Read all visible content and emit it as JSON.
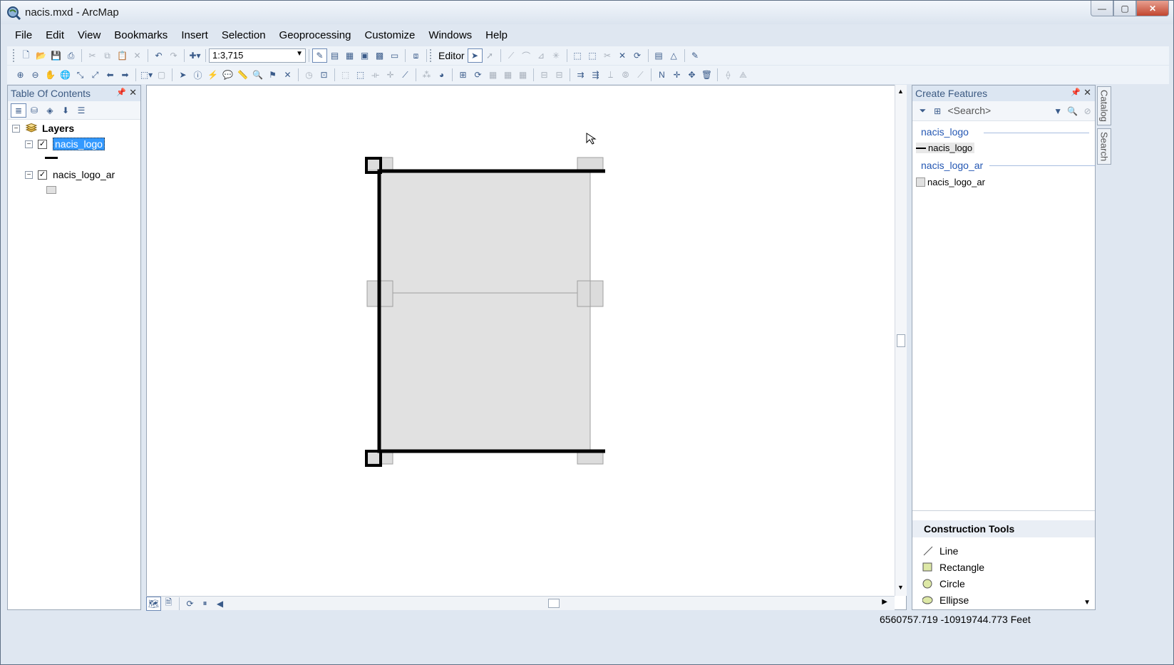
{
  "window": {
    "title": "nacis.mxd - ArcMap",
    "minimize_glyph": "—",
    "maximize_glyph": "▢",
    "close_glyph": "✕"
  },
  "menu": [
    "File",
    "Edit",
    "View",
    "Bookmarks",
    "Insert",
    "Selection",
    "Geoprocessing",
    "Customize",
    "Windows",
    "Help"
  ],
  "standard_toolbar": {
    "scale_value": "1:3,715",
    "editor_label": "Editor"
  },
  "toc": {
    "title": "Table Of Contents",
    "root_label": "Layers",
    "layers": [
      {
        "name": "nacis_logo",
        "checked": true,
        "selected": true,
        "symbol": "line"
      },
      {
        "name": "nacis_logo_ar",
        "checked": true,
        "selected": false,
        "symbol": "polygon"
      }
    ]
  },
  "create_features": {
    "title": "Create Features",
    "search_placeholder": "<Search>",
    "groups": [
      {
        "title": "nacis_logo",
        "template": "nacis_logo"
      },
      {
        "title": "nacis_logo_ar",
        "template": "nacis_logo_ar"
      }
    ],
    "construction_tools_title": "Construction Tools",
    "construction_tools": [
      "Line",
      "Rectangle",
      "Circle",
      "Ellipse"
    ]
  },
  "side_tabs": [
    "Catalog",
    "Search"
  ],
  "status": {
    "coordinates": "6560757.719  -10919744.773 Feet"
  },
  "colors": {
    "selection_highlight": "#3399ff",
    "polygon_fill": "#e1e1e1",
    "group_title": "#2457b3"
  }
}
